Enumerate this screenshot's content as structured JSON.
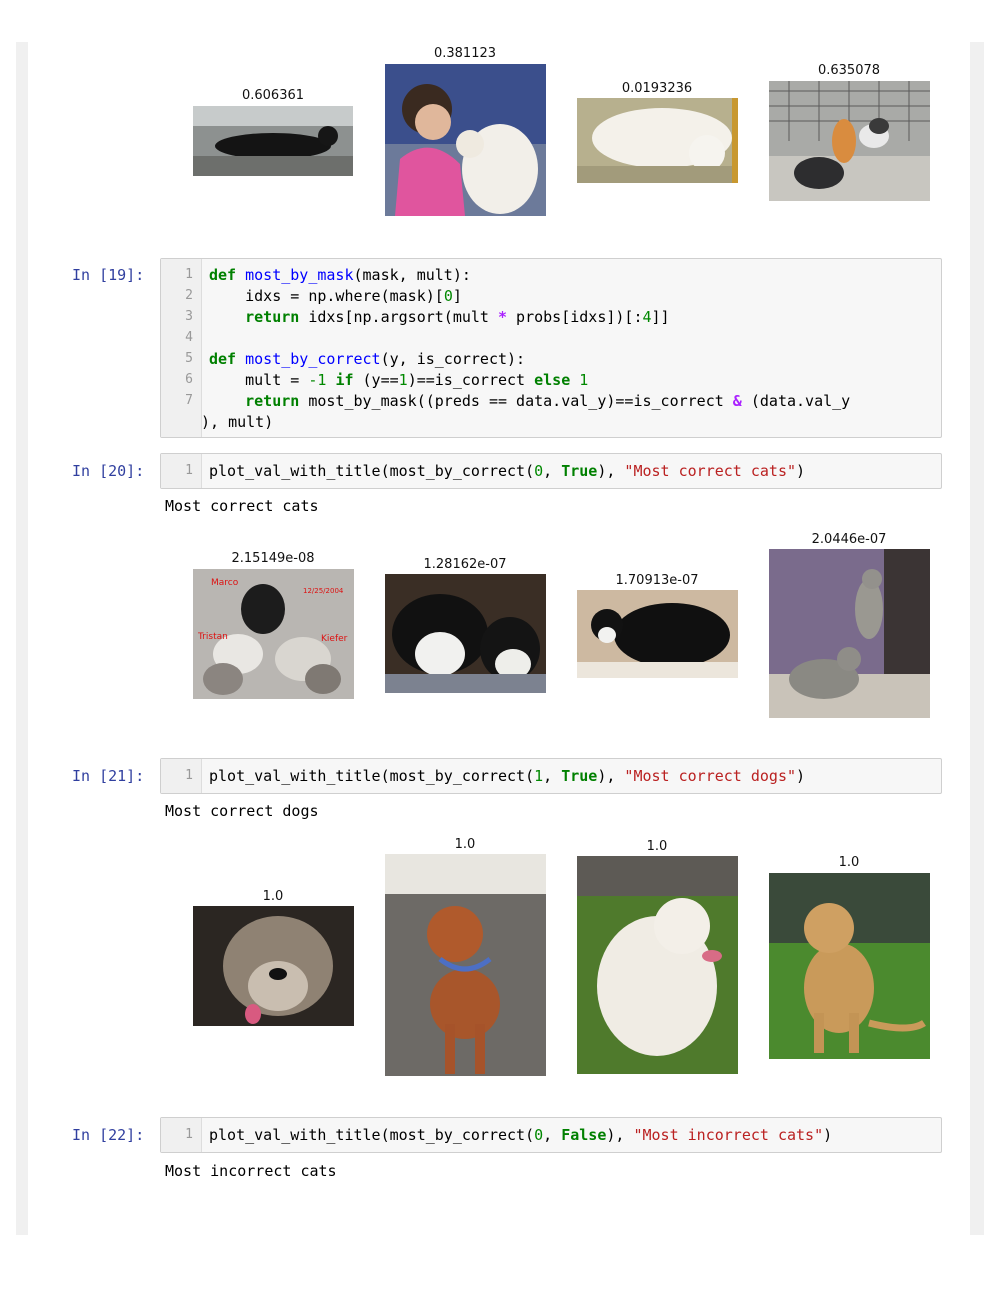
{
  "top_figure": {
    "titles": [
      "0.606361",
      "0.381123",
      "0.0193236",
      "0.635078"
    ],
    "images": [
      "black-cat-lying",
      "baby-with-white-dog",
      "white-dog-lying",
      "cats-in-cage"
    ]
  },
  "cells": [
    {
      "prompt": "In [19]:",
      "line_numbers": [
        "1",
        "2",
        "3",
        "4",
        "5",
        "6",
        "7"
      ]
    },
    {
      "prompt": "In [20]:",
      "line_numbers": [
        "1"
      ],
      "output_text": "Most correct cats",
      "figure_titles": [
        "2.15149e-08",
        "1.28162e-07",
        "1.70913e-07",
        "2.0446e-07"
      ],
      "images": [
        "cats-on-blanket",
        "black-white-cats",
        "black-cat-crouching",
        "tabby-kittens"
      ]
    },
    {
      "prompt": "In [21]:",
      "line_numbers": [
        "1"
      ],
      "output_text": "Most correct dogs",
      "figure_titles": [
        "1.0",
        "1.0",
        "1.0",
        "1.0"
      ],
      "images": [
        "grey-dog-face",
        "brown-dog-standing",
        "white-fluffy-dog",
        "tan-puppy-sitting"
      ]
    },
    {
      "prompt": "In [22]:",
      "line_numbers": [
        "1"
      ],
      "output_text": "Most incorrect cats"
    }
  ],
  "code": {
    "c19": {
      "l1_kw": "def",
      "l1_fn": "most_by_mask",
      "l1_rest": "(mask, mult):",
      "l2": "    idxs = np.where(mask)[",
      "l2_num": "0",
      "l2_end": "]",
      "l3_kw": "return",
      "l3_a": " idxs[np.argsort(mult ",
      "l3_op": "*",
      "l3_b": " probs[idxs])[:",
      "l3_num": "4",
      "l3_end": "]]",
      "l5_kw": "def",
      "l5_fn": "most_by_correct",
      "l5_rest": "(y, is_correct):",
      "l6_a": "    mult = ",
      "l6_num1": "-1",
      "l6_kw1": "if",
      "l6_b": " (y==",
      "l6_num2": "1",
      "l6_c": ")==is_correct ",
      "l6_kw2": "else",
      "l6_num3": "1",
      "l7_kw": "return",
      "l7_a": " most_by_mask((preds == data.val_y)==is_correct ",
      "l7_op": "&",
      "l7_b": " (data.val_y",
      "l8": "), mult)"
    },
    "c20": {
      "a": "plot_val_with_title(most_by_correct(",
      "n": "0",
      "b": ", ",
      "kw": "True",
      "c": "), ",
      "s": "\"Most correct cats\"",
      "d": ")"
    },
    "c21": {
      "a": "plot_val_with_title(most_by_correct(",
      "n": "1",
      "b": ", ",
      "kw": "True",
      "c": "), ",
      "s": "\"Most correct dogs\"",
      "d": ")"
    },
    "c22": {
      "a": "plot_val_with_title(most_by_correct(",
      "n": "0",
      "b": ", ",
      "kw": "False",
      "c": "), ",
      "s": "\"Most incorrect cats\"",
      "d": ")"
    }
  }
}
